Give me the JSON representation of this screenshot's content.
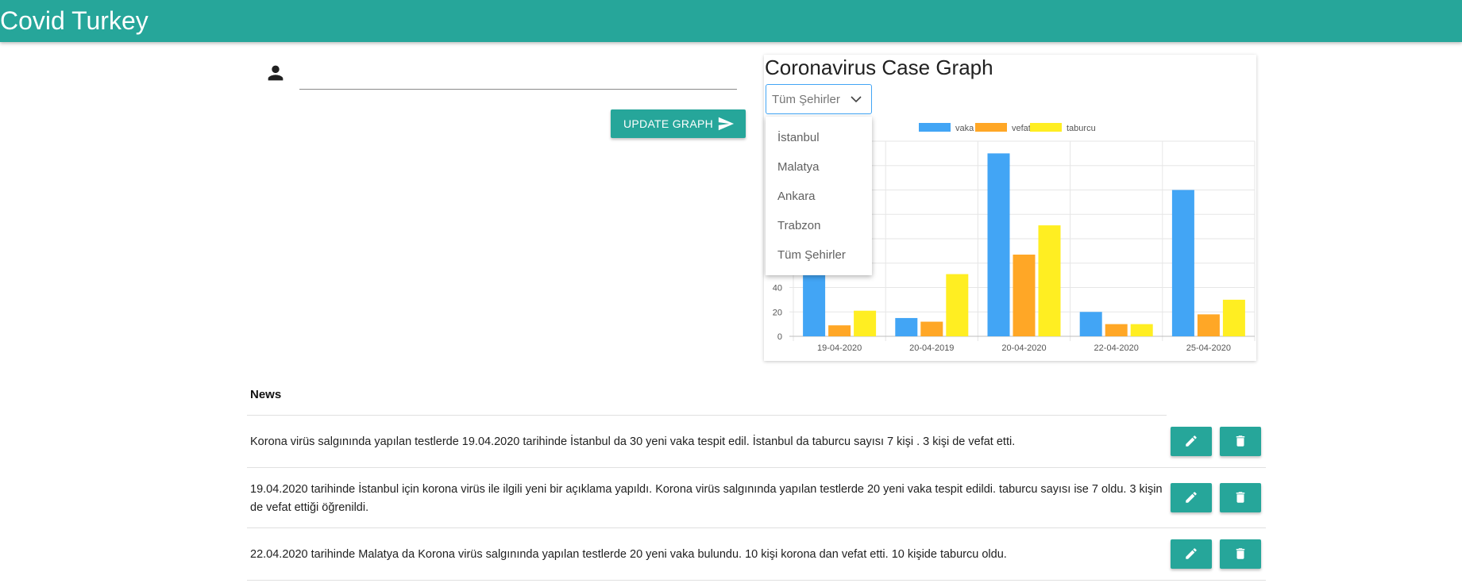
{
  "app": {
    "title": "Covid Turkey"
  },
  "form": {
    "input_value": "",
    "update_label": "UPDATE GRAPH"
  },
  "chart_panel": {
    "title": "Coronavirus Case Graph",
    "select": {
      "value": "Tüm Şehirler",
      "options": [
        "İstanbul",
        "Malatya",
        "Ankara",
        "Trabzon",
        "Tüm Şehirler"
      ]
    }
  },
  "chart_data": {
    "type": "bar",
    "categories": [
      "19-04-2020",
      "20-04-2019",
      "20-04-2020",
      "22-04-2020",
      "25-04-2020"
    ],
    "series": [
      {
        "name": "vaka",
        "color": "#42a5f5",
        "values": [
          74,
          15,
          150,
          20,
          120
        ]
      },
      {
        "name": "vefat",
        "color": "#ffa726",
        "values": [
          9,
          12,
          67,
          10,
          18
        ]
      },
      {
        "name": "taburcu",
        "color": "#ffee22",
        "values": [
          21,
          51,
          91,
          10,
          30
        ]
      }
    ],
    "yticks": [
      0,
      20,
      40
    ],
    "ylim": [
      0,
      160
    ],
    "grid": true,
    "legend": "top"
  },
  "news": {
    "heading": "News",
    "items": [
      {
        "text": "Korona virüs salgınında yapılan testlerde 19.04.2020 tarihinde İstanbul da 30 yeni vaka tespit edil. İstanbul da taburcu sayısı 7 kişi . 3 kişi de vefat etti."
      },
      {
        "text": "19.04.2020 tarihinde İstanbul için korona virüs ile ilgili yeni bir açıklama yapıldı. Korona virüs salgınında yapılan testlerde 20 yeni vaka tespit edildi. taburcu sayısı ise 7 oldu. 3 kişin de vefat ettiği öğrenildi."
      },
      {
        "text": "22.04.2020 tarihinde Malatya da Korona virüs salgınında yapılan testlerde 20 yeni vaka bulundu. 10 kişi korona dan vefat etti. 10 kişide taburcu oldu."
      }
    ]
  },
  "icons": {
    "user": "person-icon",
    "send": "send-icon",
    "chevron": "chevron-down-icon",
    "edit": "pencil-icon",
    "delete": "trash-icon"
  },
  "colors": {
    "primary": "#26a69a",
    "select_border": "#42a5f5"
  }
}
